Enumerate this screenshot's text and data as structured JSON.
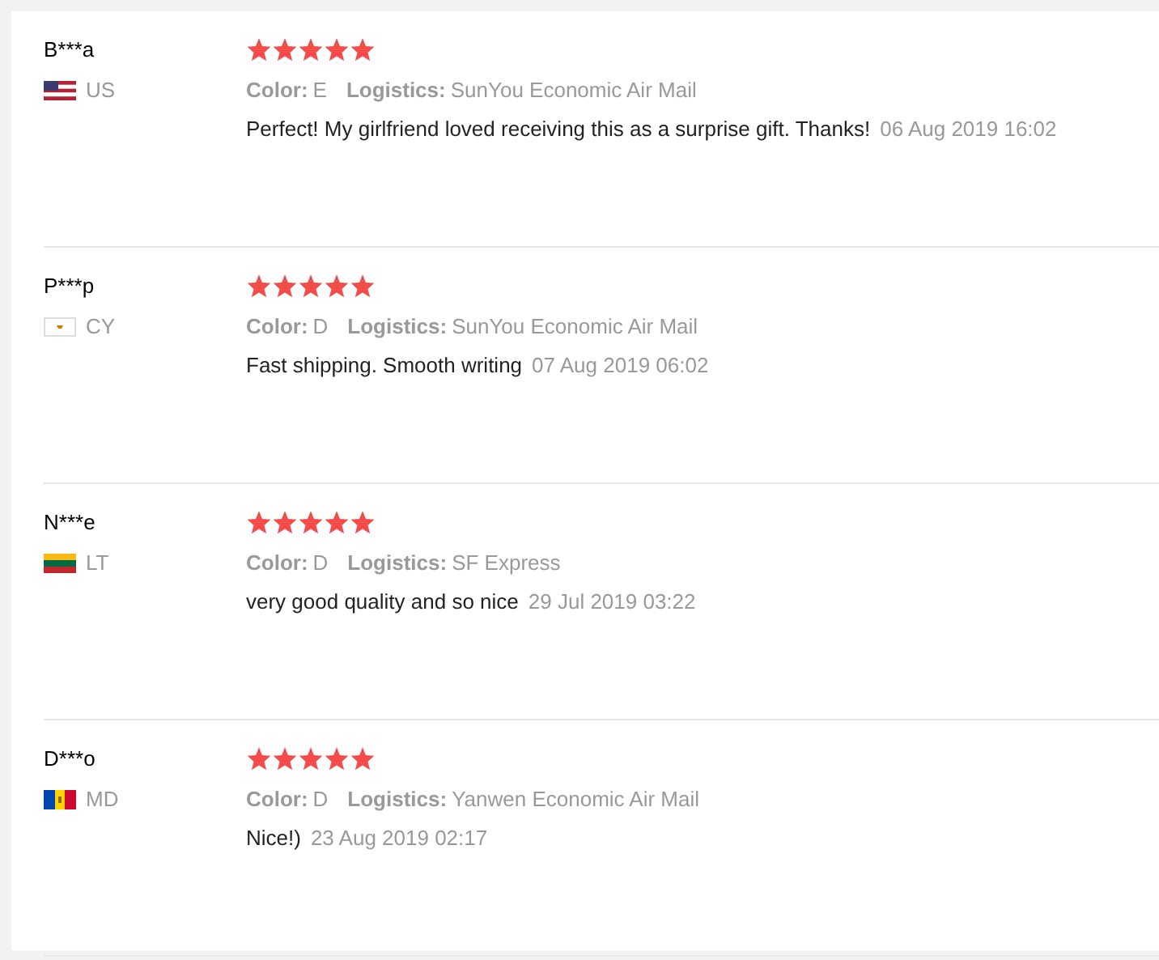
{
  "reviews": [
    {
      "name": "B***a",
      "country": "US",
      "stars": 5,
      "color_label": "Color:",
      "color_value": "E",
      "logistics_label": "Logistics:",
      "logistics_value": "SunYou Economic Air Mail",
      "text": "Perfect! My girlfriend loved receiving this as a surprise gift. Thanks!",
      "date": "06 Aug 2019 16:02"
    },
    {
      "name": "P***p",
      "country": "CY",
      "stars": 5,
      "color_label": "Color:",
      "color_value": "D",
      "logistics_label": "Logistics:",
      "logistics_value": "SunYou Economic Air Mail",
      "text": "Fast shipping. Smooth writing",
      "date": "07 Aug 2019 06:02"
    },
    {
      "name": "N***e",
      "country": "LT",
      "stars": 5,
      "color_label": "Color:",
      "color_value": "D",
      "logistics_label": "Logistics:",
      "logistics_value": "SF Express",
      "text": "very good quality and so nice",
      "date": "29 Jul 2019 03:22"
    },
    {
      "name": "D***o",
      "country": "MD",
      "stars": 5,
      "color_label": "Color:",
      "color_value": "D",
      "logistics_label": "Logistics:",
      "logistics_value": "Yanwen Economic Air Mail",
      "text": "Nice!)",
      "date": "23 Aug 2019 02:17"
    }
  ]
}
